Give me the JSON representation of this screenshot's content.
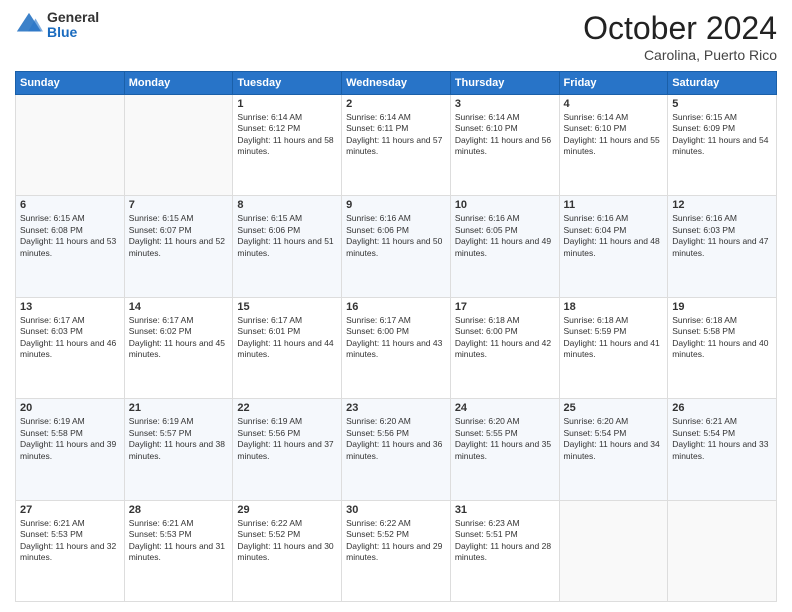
{
  "logo": {
    "general": "General",
    "blue": "Blue"
  },
  "header": {
    "title": "October 2024",
    "subtitle": "Carolina, Puerto Rico"
  },
  "weekdays": [
    "Sunday",
    "Monday",
    "Tuesday",
    "Wednesday",
    "Thursday",
    "Friday",
    "Saturday"
  ],
  "weeks": [
    [
      {
        "day": "",
        "content": ""
      },
      {
        "day": "",
        "content": ""
      },
      {
        "day": "1",
        "content": "Sunrise: 6:14 AM\nSunset: 6:12 PM\nDaylight: 11 hours and 58 minutes."
      },
      {
        "day": "2",
        "content": "Sunrise: 6:14 AM\nSunset: 6:11 PM\nDaylight: 11 hours and 57 minutes."
      },
      {
        "day": "3",
        "content": "Sunrise: 6:14 AM\nSunset: 6:10 PM\nDaylight: 11 hours and 56 minutes."
      },
      {
        "day": "4",
        "content": "Sunrise: 6:14 AM\nSunset: 6:10 PM\nDaylight: 11 hours and 55 minutes."
      },
      {
        "day": "5",
        "content": "Sunrise: 6:15 AM\nSunset: 6:09 PM\nDaylight: 11 hours and 54 minutes."
      }
    ],
    [
      {
        "day": "6",
        "content": "Sunrise: 6:15 AM\nSunset: 6:08 PM\nDaylight: 11 hours and 53 minutes."
      },
      {
        "day": "7",
        "content": "Sunrise: 6:15 AM\nSunset: 6:07 PM\nDaylight: 11 hours and 52 minutes."
      },
      {
        "day": "8",
        "content": "Sunrise: 6:15 AM\nSunset: 6:06 PM\nDaylight: 11 hours and 51 minutes."
      },
      {
        "day": "9",
        "content": "Sunrise: 6:16 AM\nSunset: 6:06 PM\nDaylight: 11 hours and 50 minutes."
      },
      {
        "day": "10",
        "content": "Sunrise: 6:16 AM\nSunset: 6:05 PM\nDaylight: 11 hours and 49 minutes."
      },
      {
        "day": "11",
        "content": "Sunrise: 6:16 AM\nSunset: 6:04 PM\nDaylight: 11 hours and 48 minutes."
      },
      {
        "day": "12",
        "content": "Sunrise: 6:16 AM\nSunset: 6:03 PM\nDaylight: 11 hours and 47 minutes."
      }
    ],
    [
      {
        "day": "13",
        "content": "Sunrise: 6:17 AM\nSunset: 6:03 PM\nDaylight: 11 hours and 46 minutes."
      },
      {
        "day": "14",
        "content": "Sunrise: 6:17 AM\nSunset: 6:02 PM\nDaylight: 11 hours and 45 minutes."
      },
      {
        "day": "15",
        "content": "Sunrise: 6:17 AM\nSunset: 6:01 PM\nDaylight: 11 hours and 44 minutes."
      },
      {
        "day": "16",
        "content": "Sunrise: 6:17 AM\nSunset: 6:00 PM\nDaylight: 11 hours and 43 minutes."
      },
      {
        "day": "17",
        "content": "Sunrise: 6:18 AM\nSunset: 6:00 PM\nDaylight: 11 hours and 42 minutes."
      },
      {
        "day": "18",
        "content": "Sunrise: 6:18 AM\nSunset: 5:59 PM\nDaylight: 11 hours and 41 minutes."
      },
      {
        "day": "19",
        "content": "Sunrise: 6:18 AM\nSunset: 5:58 PM\nDaylight: 11 hours and 40 minutes."
      }
    ],
    [
      {
        "day": "20",
        "content": "Sunrise: 6:19 AM\nSunset: 5:58 PM\nDaylight: 11 hours and 39 minutes."
      },
      {
        "day": "21",
        "content": "Sunrise: 6:19 AM\nSunset: 5:57 PM\nDaylight: 11 hours and 38 minutes."
      },
      {
        "day": "22",
        "content": "Sunrise: 6:19 AM\nSunset: 5:56 PM\nDaylight: 11 hours and 37 minutes."
      },
      {
        "day": "23",
        "content": "Sunrise: 6:20 AM\nSunset: 5:56 PM\nDaylight: 11 hours and 36 minutes."
      },
      {
        "day": "24",
        "content": "Sunrise: 6:20 AM\nSunset: 5:55 PM\nDaylight: 11 hours and 35 minutes."
      },
      {
        "day": "25",
        "content": "Sunrise: 6:20 AM\nSunset: 5:54 PM\nDaylight: 11 hours and 34 minutes."
      },
      {
        "day": "26",
        "content": "Sunrise: 6:21 AM\nSunset: 5:54 PM\nDaylight: 11 hours and 33 minutes."
      }
    ],
    [
      {
        "day": "27",
        "content": "Sunrise: 6:21 AM\nSunset: 5:53 PM\nDaylight: 11 hours and 32 minutes."
      },
      {
        "day": "28",
        "content": "Sunrise: 6:21 AM\nSunset: 5:53 PM\nDaylight: 11 hours and 31 minutes."
      },
      {
        "day": "29",
        "content": "Sunrise: 6:22 AM\nSunset: 5:52 PM\nDaylight: 11 hours and 30 minutes."
      },
      {
        "day": "30",
        "content": "Sunrise: 6:22 AM\nSunset: 5:52 PM\nDaylight: 11 hours and 29 minutes."
      },
      {
        "day": "31",
        "content": "Sunrise: 6:23 AM\nSunset: 5:51 PM\nDaylight: 11 hours and 28 minutes."
      },
      {
        "day": "",
        "content": ""
      },
      {
        "day": "",
        "content": ""
      }
    ]
  ]
}
